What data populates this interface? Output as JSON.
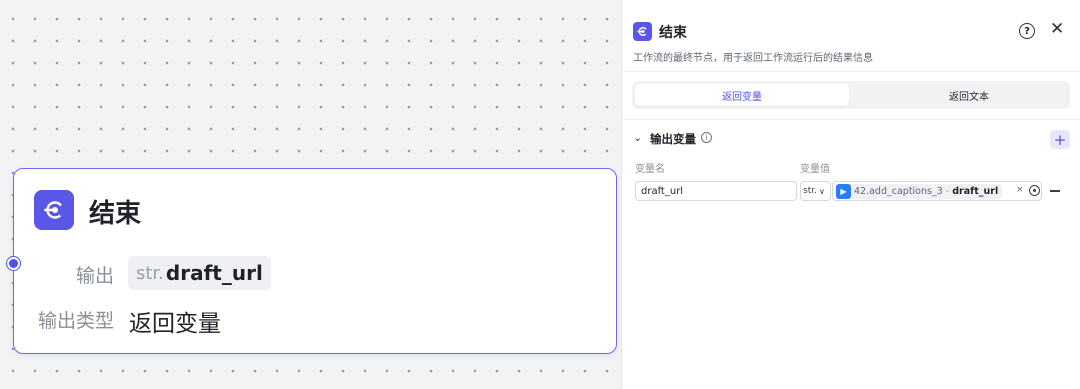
{
  "canvas": {
    "node": {
      "title": "结束",
      "output_label": "输出",
      "output_type_prefix": "str.",
      "output_var": "draft_url",
      "output_type_label": "输出类型",
      "output_type_value": "返回变量"
    }
  },
  "panel": {
    "title": "结束",
    "description": "工作流的最终节点，用于返回工作流运行后的结果信息",
    "help_icon": "?",
    "close_icon": "✕",
    "tabs": [
      {
        "label": "返回变量",
        "active": true
      },
      {
        "label": "返回文本",
        "active": false
      }
    ],
    "section": {
      "chevron": "⌄",
      "title": "输出变量",
      "info_icon": "i",
      "add_icon": "+",
      "col_name": "变量名",
      "col_value": "变量值",
      "rows": [
        {
          "name": "draft_url",
          "type": "str.",
          "type_chevron": "∨",
          "ref_node": "42.add_captions_3",
          "ref_sep": "-",
          "ref_var": "draft_url",
          "clear_icon": "×"
        }
      ]
    }
  },
  "colors": {
    "accent": "#4d53e8",
    "node_icon": "#5b57e6",
    "ref_icon": "#2a7ef5"
  },
  "icons": {
    "end_node_icon": "end-node-icon",
    "ref_node_icon": "play-icon"
  }
}
